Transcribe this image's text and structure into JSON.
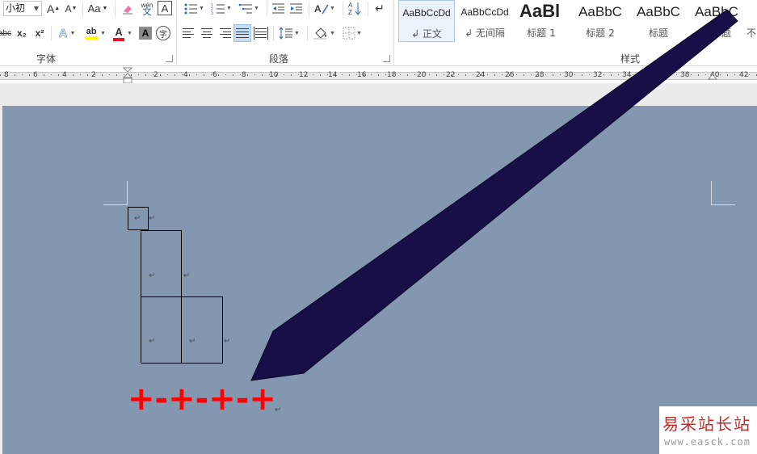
{
  "ribbon": {
    "font_group": {
      "font_size": "小初",
      "grow_font": "A",
      "shrink_font": "A",
      "change_case": "Aa",
      "clear_format_icon": "eraser-icon",
      "phonetic_top": "wén",
      "phonetic_bottom": "文",
      "char_border": "A",
      "strikethrough": "abc",
      "subscript": "x₂",
      "superscript": "x²",
      "text_effects": "A",
      "highlight": "ab",
      "font_color": "A",
      "char_shading": "A",
      "enclose_char": "字",
      "label": "字体"
    },
    "paragraph_group": {
      "sort": "A↓Z",
      "show_marks": "↵",
      "label": "段落"
    },
    "styles_group": {
      "label": "样式",
      "styles": [
        {
          "preview": "AaBbCcDd",
          "name": "↲ 正文"
        },
        {
          "preview": "AaBbCcDd",
          "name": "↲ 无间隔"
        },
        {
          "preview": "AaBl",
          "name": "标题 1"
        },
        {
          "preview": "AaBbC",
          "name": "标题 2"
        },
        {
          "preview": "AaBbC",
          "name": "标题"
        },
        {
          "preview": "AaBbC",
          "name": "副标题"
        },
        {
          "preview": "",
          "name": "不"
        }
      ]
    }
  },
  "ruler": {
    "numbers": [
      "8",
      "6",
      "4",
      "2",
      "2",
      "4",
      "6",
      "8",
      "10",
      "12",
      "14",
      "16",
      "18",
      "20",
      "22",
      "24",
      "26",
      "28",
      "30",
      "32",
      "34",
      "36",
      "38",
      "40",
      "42"
    ]
  },
  "document": {
    "paragraph_mark": "↵",
    "formula": "+-+-+-+"
  },
  "watermark": {
    "title": "易采站长站",
    "url": "www.easck.com"
  },
  "colors": {
    "page_background": "#8497b0",
    "formula_red": "#ff0000",
    "arrow_fill": "#170f45"
  }
}
